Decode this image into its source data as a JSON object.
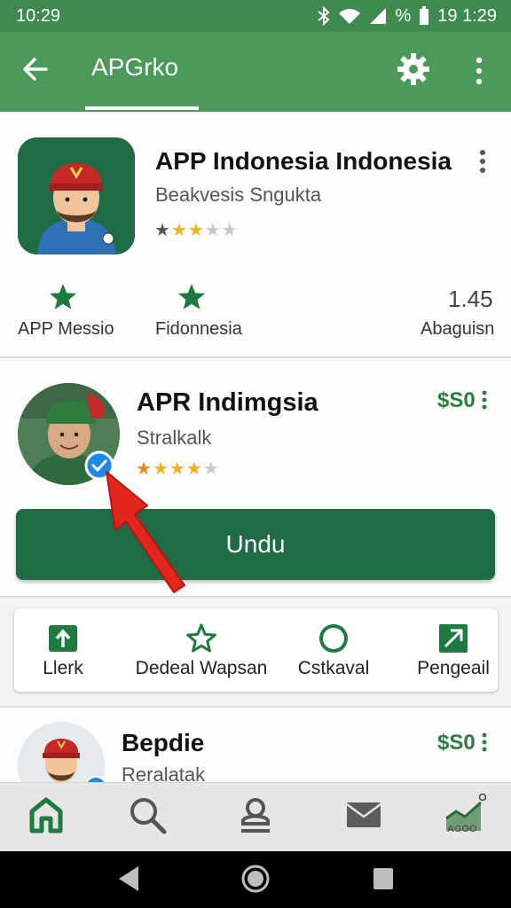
{
  "status_bar": {
    "time": "10:29",
    "battery_text": "%",
    "clock_right": "19 1:29"
  },
  "app_bar": {
    "title": "APGrko",
    "back_icon": "arrow-left-icon",
    "settings_icon": "gear-icon",
    "overflow_icon": "more-vert-icon"
  },
  "featured": {
    "title": "APP Indonesia Indonesia",
    "subtitle": "Beakvesis Sngukta",
    "rating": 2,
    "rating_max": 5,
    "stats": [
      {
        "label": "APP Messio",
        "icon": "star-icon"
      },
      {
        "label": "Fidonnesia",
        "icon": "star-icon"
      },
      {
        "value": "1.45",
        "label": "Abaguisn"
      }
    ]
  },
  "app2": {
    "title": "APR Indimgsia",
    "subtitle": "Stralkalk",
    "price": "$S0",
    "rating": 4,
    "rating_max": 5,
    "install_label": "Undu"
  },
  "actions": [
    {
      "label": "Llerk",
      "icon": "upload-icon"
    },
    {
      "label": "Dedeal Wapsan",
      "icon": "star-outline-icon"
    },
    {
      "label": "Cstkaval",
      "icon": "circle-outline-icon"
    },
    {
      "label": "Pengeail",
      "icon": "open-external-icon"
    }
  ],
  "app3": {
    "title": "Bepdie",
    "subtitle": "Reralatak",
    "price": "$S0"
  },
  "bottom_nav": [
    {
      "name": "home",
      "icon": "home-icon"
    },
    {
      "name": "search",
      "icon": "search-icon"
    },
    {
      "name": "account",
      "icon": "person-icon"
    },
    {
      "name": "mail",
      "icon": "mail-icon"
    },
    {
      "name": "charts",
      "icon": "chart-icon",
      "label": "AGOO"
    }
  ],
  "colors": {
    "status_bar": "#3f8a4f",
    "app_bar": "#4c9a5a",
    "install_button": "#1e6b45",
    "price": "#2e7d3e",
    "star": "#f2b01e"
  }
}
